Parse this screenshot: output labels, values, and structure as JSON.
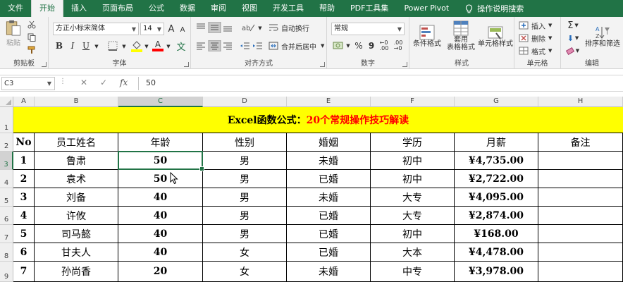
{
  "menu_tabs": [
    "文件",
    "开始",
    "插入",
    "页面布局",
    "公式",
    "数据",
    "审阅",
    "视图",
    "开发工具",
    "帮助",
    "PDF工具集",
    "Power Pivot"
  ],
  "active_tab_index": 1,
  "tell_me": "操作说明搜索",
  "ribbon": {
    "clipboard": {
      "paste": "粘贴",
      "label": "剪贴板"
    },
    "font": {
      "name": "方正小标宋简体",
      "size": "14",
      "bold": "B",
      "italic": "I",
      "underline": "U",
      "grow": "A",
      "shrink": "A",
      "fill_color": "#ffff00",
      "font_color": "#ff0000",
      "label": "字体"
    },
    "alignment": {
      "wrap": "自动换行",
      "merge": "合并后居中",
      "label": "对齐方式"
    },
    "number": {
      "format": "常规",
      "percent": "%",
      "comma": "9",
      "label": "数字"
    },
    "styles": {
      "conditional": [
        "条件格式",
        ""
      ],
      "table": [
        "套用",
        "表格格式"
      ],
      "cell": [
        "单元格样式",
        ""
      ],
      "label": "样式"
    },
    "cells": {
      "insert": "插入",
      "delete": "删除",
      "format": "格式",
      "label": "单元格"
    },
    "editing": {
      "sort": [
        "排序和筛选",
        ""
      ],
      "label": "编辑"
    }
  },
  "formula_bar": {
    "name_box": "C3",
    "cancel": "✕",
    "enter": "✓",
    "fx": "fx",
    "value": "50"
  },
  "columns": [
    "A",
    "B",
    "C",
    "D",
    "E",
    "F",
    "G",
    "H"
  ],
  "selected_column": "C",
  "rows": [
    "1",
    "2",
    "3",
    "4",
    "5",
    "6",
    "7",
    "8",
    "9"
  ],
  "selected_row": "3",
  "sheet": {
    "title_black": "Excel函数公式：",
    "title_red": "20个常规操作技巧解读",
    "title_bg": "#ffff00",
    "title_red_color": "#ff0000",
    "headers": [
      "No",
      "员工姓名",
      "年龄",
      "性别",
      "婚姻",
      "学历",
      "月薪",
      "备注"
    ],
    "data": [
      [
        "1",
        "鲁肃",
        "50",
        "男",
        "未婚",
        "初中",
        "¥4,735.00",
        ""
      ],
      [
        "2",
        "袁术",
        "50",
        "男",
        "已婚",
        "初中",
        "¥2,722.00",
        ""
      ],
      [
        "3",
        "刘备",
        "40",
        "男",
        "未婚",
        "大专",
        "¥4,095.00",
        ""
      ],
      [
        "4",
        "许攸",
        "40",
        "男",
        "已婚",
        "大专",
        "¥2,874.00",
        ""
      ],
      [
        "5",
        "司马懿",
        "40",
        "男",
        "已婚",
        "初中",
        "¥168.00",
        ""
      ],
      [
        "6",
        "甘夫人",
        "40",
        "女",
        "已婚",
        "大本",
        "¥4,478.00",
        ""
      ],
      [
        "7",
        "孙尚香",
        "20",
        "女",
        "未婚",
        "中专",
        "¥3,978.00",
        ""
      ]
    ]
  }
}
